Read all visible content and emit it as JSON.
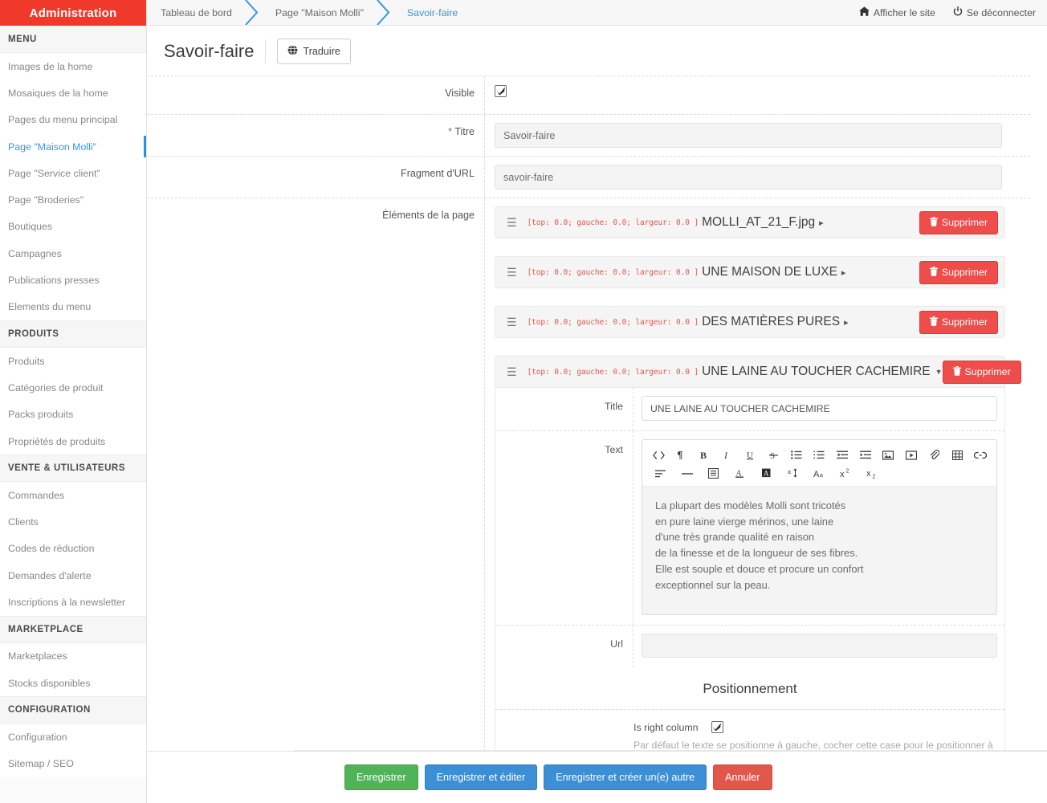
{
  "sidebar": {
    "brand": "Administration",
    "groups": [
      {
        "title": "MENU",
        "items": [
          {
            "label": "Images de la home",
            "active": false
          },
          {
            "label": "Mosaiques de la home",
            "active": false
          },
          {
            "label": "Pages du menu principal",
            "active": false
          },
          {
            "label": "Page \"Maison Molli\"",
            "active": true
          },
          {
            "label": "Page \"Service client\"",
            "active": false
          },
          {
            "label": "Page \"Broderies\"",
            "active": false
          },
          {
            "label": "Boutiques",
            "active": false
          },
          {
            "label": "Campagnes",
            "active": false
          },
          {
            "label": "Publications presses",
            "active": false
          },
          {
            "label": "Elements du menu",
            "active": false
          }
        ]
      },
      {
        "title": "PRODUITS",
        "items": [
          {
            "label": "Produits",
            "active": false
          },
          {
            "label": "Catégories de produit",
            "active": false
          },
          {
            "label": "Packs produits",
            "active": false
          },
          {
            "label": "Propriétés de produits",
            "active": false
          }
        ]
      },
      {
        "title": "VENTE & UTILISATEURS",
        "items": [
          {
            "label": "Commandes",
            "active": false
          },
          {
            "label": "Clients",
            "active": false
          },
          {
            "label": "Codes de réduction",
            "active": false
          },
          {
            "label": "Demandes d'alerte",
            "active": false
          },
          {
            "label": "Inscriptions à la newsletter",
            "active": false
          }
        ]
      },
      {
        "title": "MARKETPLACE",
        "items": [
          {
            "label": "Marketplaces",
            "active": false
          },
          {
            "label": "Stocks disponibles",
            "active": false
          }
        ]
      },
      {
        "title": "CONFIGURATION",
        "items": [
          {
            "label": "Configuration",
            "active": false
          },
          {
            "label": "Sitemap / SEO",
            "active": false
          }
        ]
      }
    ]
  },
  "topbar": {
    "breadcrumbs": [
      {
        "label": "Tableau de bord",
        "current": false
      },
      {
        "label": "Page \"Maison Molli\"",
        "current": false
      },
      {
        "label": "Savoir-faire",
        "current": true
      }
    ],
    "view_site": "Afficher le site",
    "logout": "Se déconnecter"
  },
  "page": {
    "title": "Savoir-faire",
    "translate_button": "Traduire"
  },
  "form": {
    "visible_label": "Visible",
    "visible_checked": true,
    "title_label": "Titre",
    "title_required_mark": "*",
    "title_value": "Savoir-faire",
    "url_label": "Fragment d'URL",
    "url_value": "savoir-faire",
    "elements_label": "Éléments de la page"
  },
  "page_elements": [
    {
      "coords": "[top: 0.0; gauche: 0.0; largeur: 0.0 ]",
      "title": "MOLLI_AT_21_F.jpg",
      "expanded": false,
      "delete_label": "Supprimer"
    },
    {
      "coords": "[top: 0.0; gauche: 0.0; largeur: 0.0 ]",
      "title": "UNE MAISON DE LUXE",
      "expanded": false,
      "delete_label": "Supprimer"
    },
    {
      "coords": "[top: 0.0; gauche: 0.0; largeur: 0.0 ]",
      "title": "DES MATIÈRES PURES",
      "expanded": false,
      "delete_label": "Supprimer"
    },
    {
      "coords": "[top: 0.0; gauche: 0.0; largeur: 0.0 ]",
      "title": "UNE LAINE AU TOUCHER CACHEMIRE",
      "expanded": true,
      "delete_label": "Supprimer"
    }
  ],
  "expanded_element": {
    "title_label": "Title",
    "title_value": "UNE LAINE AU TOUCHER CACHEMIRE",
    "text_label": "Text",
    "text_value": "La plupart des modèles Molli sont tricotés\nen pure laine vierge mérinos, une laine\nd'une très grande qualité en raison\nde la finesse et de la longueur de ses fibres.\nElle est souple et douce et procure un confort\nexceptionnel sur la peau.",
    "url_label": "Url",
    "url_value": "",
    "section_title": "Positionnement",
    "right_column_label": "Is right column",
    "right_column_checked": true,
    "right_column_hint": "Par défaut le texte se positionne à gauche, cocher cette case pour le positionner à droite.",
    "toolbar_row1": [
      "code-icon",
      "paragraph-icon",
      "bold-icon",
      "italic-icon",
      "underline-icon",
      "strikethrough-icon",
      "unordered-list-icon",
      "ordered-list-icon",
      "outdent-icon",
      "indent-icon",
      "image-icon",
      "video-icon",
      "attachment-icon",
      "table-icon",
      "link-icon"
    ],
    "toolbar_row2": [
      "align-icon",
      "horizontal-rule-icon",
      "blockquote-icon",
      "text-color-icon",
      "highlight-icon",
      "line-height-icon",
      "font-size-icon",
      "superscript-icon",
      "subscript-icon"
    ]
  },
  "footer": {
    "save": "Enregistrer",
    "save_edit": "Enregistrer et éditer",
    "save_new": "Enregistrer et créer un(e) autre",
    "cancel": "Annuler"
  },
  "colors": {
    "brand_red": "#f0392b",
    "accent_blue": "#3a96dd",
    "danger": "#ef4c4c",
    "success": "#51b358",
    "coords_red": "#e2584d"
  }
}
